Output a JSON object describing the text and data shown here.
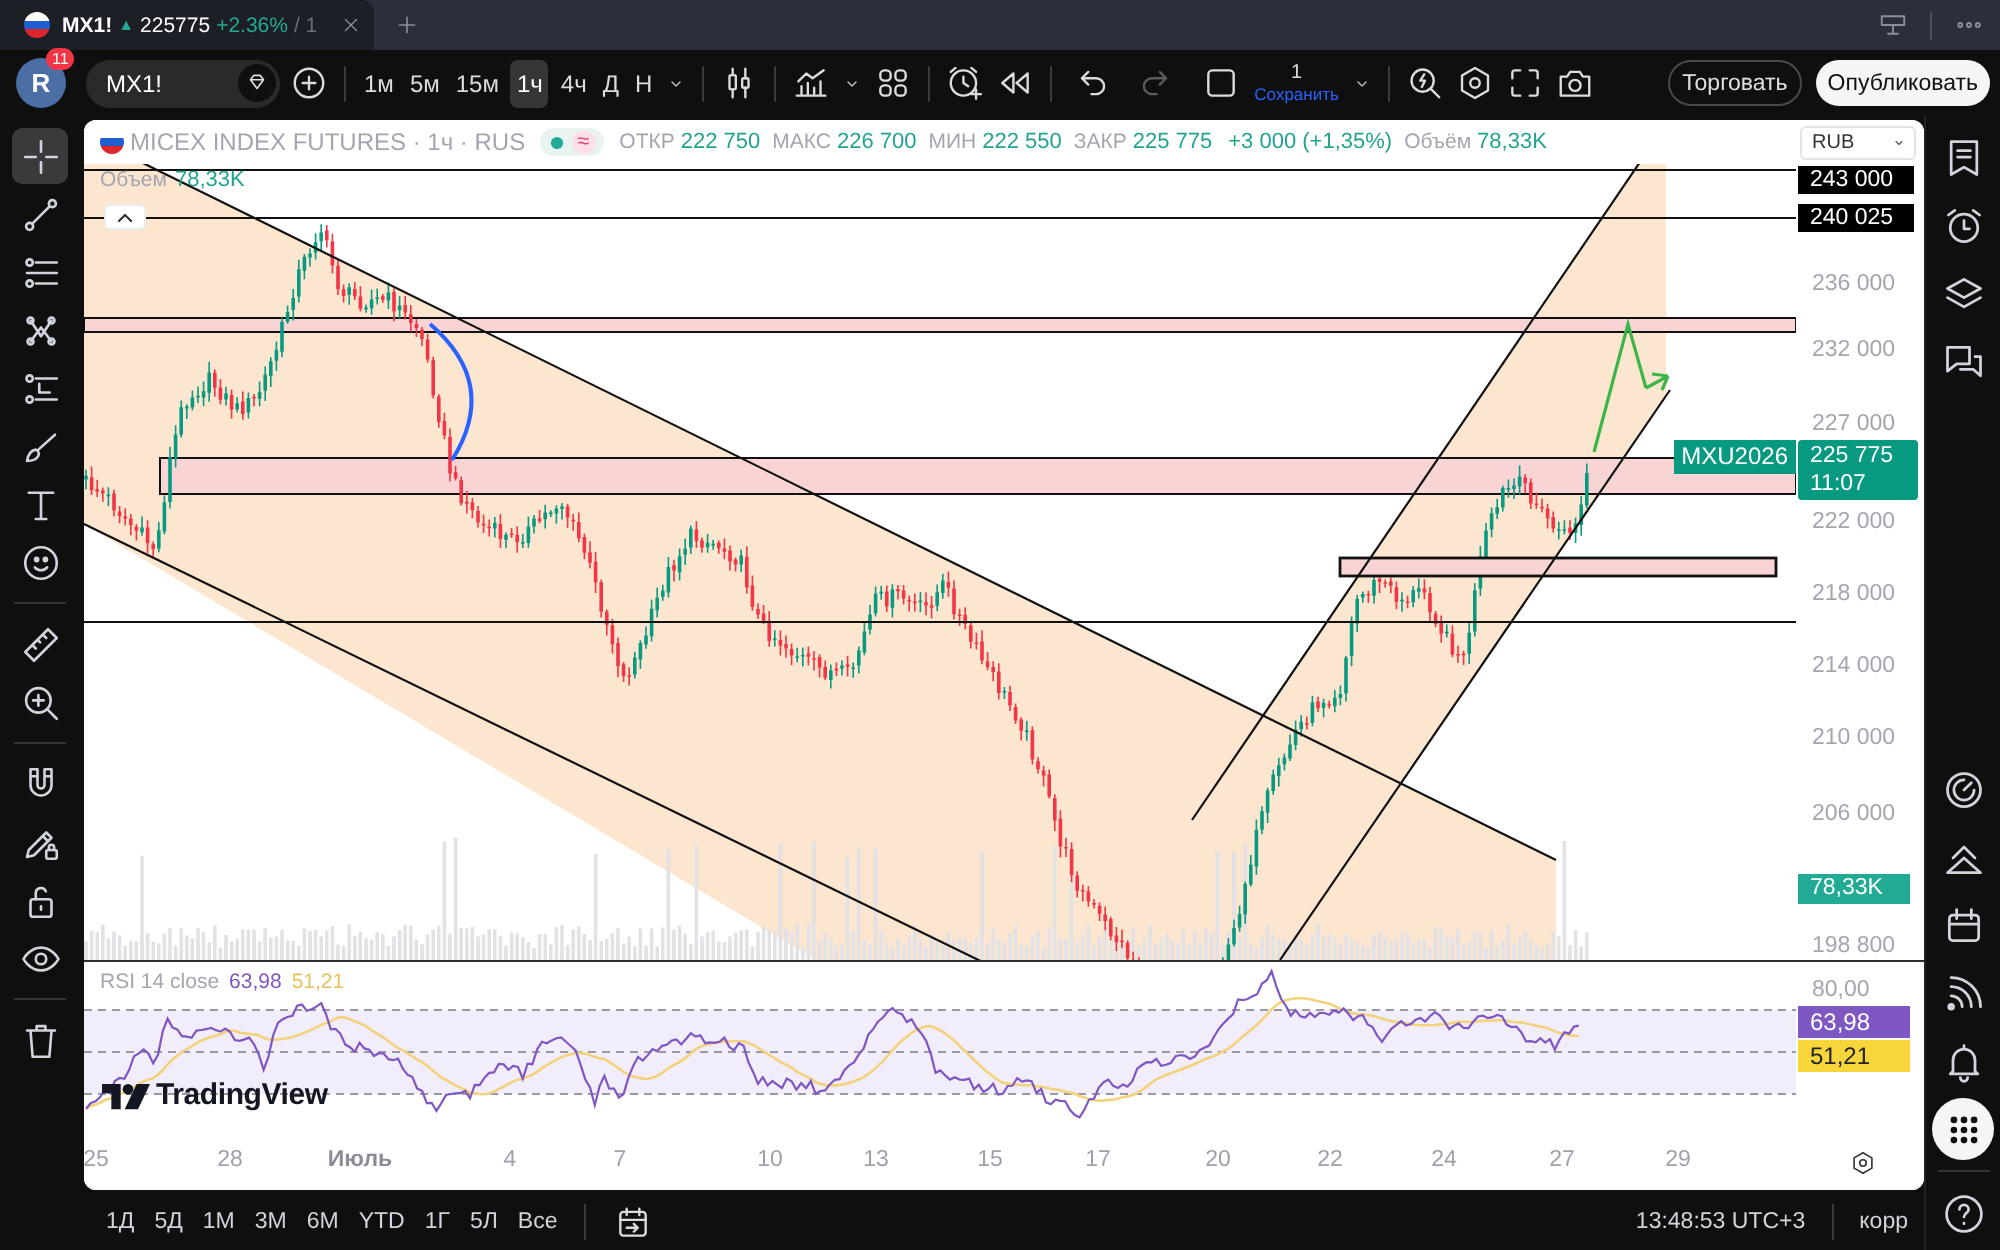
{
  "browser_tab": {
    "symbol": "MX1!",
    "arrow": "▲",
    "price": "225775",
    "change": "+2.36%",
    "suffix": "/ 1"
  },
  "toolbar": {
    "avatar_letter": "R",
    "notification_count": "11",
    "symbol": "MX1!",
    "intervals": [
      {
        "label": "1м",
        "selected": false
      },
      {
        "label": "5м",
        "selected": false
      },
      {
        "label": "15м",
        "selected": false
      },
      {
        "label": "1ч",
        "selected": true
      },
      {
        "label": "4ч",
        "selected": false
      },
      {
        "label": "Д",
        "selected": false
      },
      {
        "label": "Н",
        "selected": false
      }
    ],
    "history": [
      {
        "disabled": false
      },
      {
        "disabled": true
      }
    ],
    "layout_count": "1",
    "save_label": "Сохранить",
    "trade_button": "Торговать",
    "publish_button": "Опубликовать"
  },
  "drawing_tools": [
    {
      "selected": true
    },
    {
      "selected": false
    },
    {
      "selected": false
    },
    {
      "selected": false
    },
    {
      "selected": false
    },
    {
      "selected": false
    },
    {
      "selected": false
    },
    {
      "selected": false
    },
    {
      "selected": false
    },
    {
      "selected": false
    },
    {
      "selected": false
    },
    {
      "selected": false
    },
    {
      "selected": false
    },
    {
      "selected": false
    },
    {
      "selected": false
    }
  ],
  "legend": {
    "title": "MICEX INDEX FUTURES · 1ч · RUS",
    "status_symbol": "≈",
    "stats": [
      {
        "label": "ОТКР",
        "value": "222 750"
      },
      {
        "label": "МАКС",
        "value": "226 700"
      },
      {
        "label": "МИН",
        "value": "222 550"
      },
      {
        "label": "ЗАКР",
        "value": "225 775"
      }
    ],
    "change": "+3 000 (+1,35%)",
    "volume_label": "Объём",
    "volume": "78,33K"
  },
  "volume_legend": {
    "label": "Объем",
    "value": "78,33K"
  },
  "currency": "RUB",
  "price_axis": {
    "line_labels": [
      "243 000",
      "240 025"
    ],
    "ticks": [
      "236 000",
      "232 000",
      "227 000",
      "222 000",
      "218 000",
      "214 000",
      "210 000",
      "206 000",
      "198 800"
    ],
    "symbol_label": "MXU2026",
    "last_price": "225 775",
    "countdown": "11:07",
    "volume_label": "78,33K"
  },
  "rsi": {
    "title": "RSI 14 close",
    "value": "63,98",
    "ma_value": "51,21",
    "axis_tick": "80,00",
    "value_label": "63,98",
    "ma_label": "51,21"
  },
  "logo": "TradingView",
  "time_axis": [
    {
      "label": "25",
      "kind": "day"
    },
    {
      "label": "28",
      "kind": "day"
    },
    {
      "label": "Июль",
      "kind": "month"
    },
    {
      "label": "4",
      "kind": "day"
    },
    {
      "label": "7",
      "kind": "day"
    },
    {
      "label": "10",
      "kind": "day"
    },
    {
      "label": "13",
      "kind": "day"
    },
    {
      "label": "15",
      "kind": "day"
    },
    {
      "label": "17",
      "kind": "day"
    },
    {
      "label": "20",
      "kind": "day"
    },
    {
      "label": "22",
      "kind": "day"
    },
    {
      "label": "24",
      "kind": "day"
    },
    {
      "label": "27",
      "kind": "day"
    },
    {
      "label": "29",
      "kind": "day"
    }
  ],
  "ranges": [
    "1Д",
    "5Д",
    "1М",
    "3М",
    "6М",
    "YTD",
    "1Г",
    "5Л",
    "Все"
  ],
  "clock": "13:48:53 UTC+3",
  "adjustment": "корр",
  "right_sidebar": {
    "top": [
      {
        "selected": false
      },
      {
        "selected": false
      },
      {
        "selected": false
      },
      {
        "selected": false
      }
    ],
    "bottom": [
      {
        "selected": false
      },
      {
        "selected": false
      },
      {
        "selected": false
      },
      {
        "selected": false
      },
      {
        "selected": false
      },
      {
        "selected": true
      },
      {
        "selected": false
      }
    ]
  }
}
